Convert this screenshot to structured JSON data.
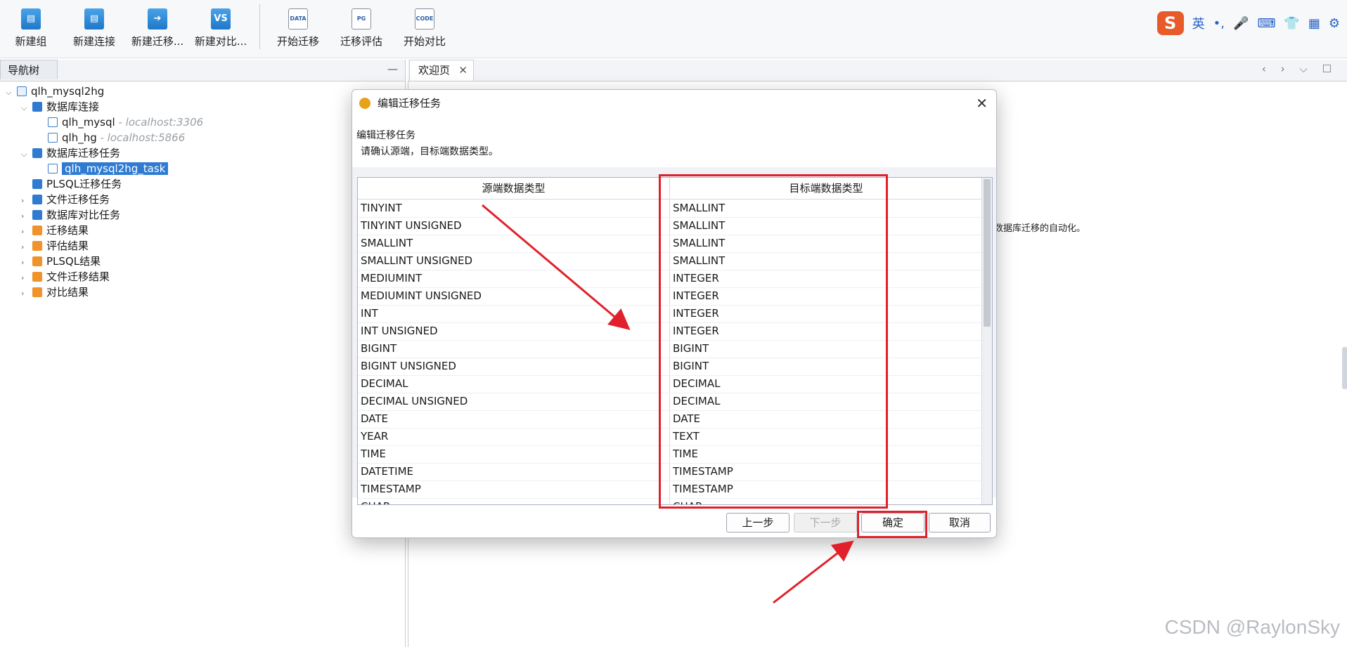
{
  "toolbar": {
    "items": [
      {
        "label": "新建组",
        "icon": "group-icon"
      },
      {
        "label": "新建连接",
        "icon": "connection-icon"
      },
      {
        "label": "新建迁移...",
        "icon": "migration-icon"
      },
      {
        "label": "新建对比...",
        "icon": "compare-icon",
        "glyph": "VS"
      },
      {
        "label": "开始迁移",
        "icon": "data-start-icon",
        "glyph": "DATA"
      },
      {
        "label": "迁移评估",
        "icon": "pg-evaluate-icon",
        "glyph": "PG"
      },
      {
        "label": "开始对比",
        "icon": "code-compare-icon",
        "glyph": "CODE"
      }
    ]
  },
  "ime": {
    "logo": "S",
    "lang": "英",
    "symbols": "•,"
  },
  "nav": {
    "tab": "导航树",
    "minimize": "—",
    "tree": {
      "root": "qlh_mysql2hg",
      "db_conn": "数据库连接",
      "conn1": "qlh_mysql",
      "conn1_host": " - localhost:3306",
      "conn2": "qlh_hg",
      "conn2_host": " - localhost:5866",
      "migration_tasks": "数据库迁移任务",
      "task1": "qlh_mysql2hg_task",
      "plsql": "PLSQL迁移任务",
      "file_mig": "文件迁移任务",
      "db_compare": "数据库对比任务",
      "mig_result": "迁移结果",
      "eval_result": "评估结果",
      "plsql_result": "PLSQL结果",
      "file_result": "文件迁移结果",
      "compare_result": "对比结果"
    }
  },
  "editor": {
    "tab": "欢迎页",
    "tab_close": "✕",
    "controls": "‹ › ⌵ ☐",
    "welcome_fragment": "数据库迁移的自动化。"
  },
  "dialog": {
    "title": "编辑迁移任务",
    "close": "✕",
    "heading": "编辑迁移任务",
    "desc": "请确认源端，目标端数据类型。",
    "col_source": "源端数据类型",
    "col_target": "目标端数据类型",
    "rows": [
      [
        "TINYINT",
        "SMALLINT"
      ],
      [
        "TINYINT UNSIGNED",
        "SMALLINT"
      ],
      [
        "SMALLINT",
        "SMALLINT"
      ],
      [
        "SMALLINT UNSIGNED",
        "SMALLINT"
      ],
      [
        "MEDIUMINT",
        "INTEGER"
      ],
      [
        "MEDIUMINT UNSIGNED",
        "INTEGER"
      ],
      [
        "INT",
        "INTEGER"
      ],
      [
        "INT UNSIGNED",
        "INTEGER"
      ],
      [
        "BIGINT",
        "BIGINT"
      ],
      [
        "BIGINT UNSIGNED",
        "BIGINT"
      ],
      [
        "DECIMAL",
        "DECIMAL"
      ],
      [
        "DECIMAL UNSIGNED",
        "DECIMAL"
      ],
      [
        "DATE",
        "DATE"
      ],
      [
        "YEAR",
        "TEXT"
      ],
      [
        "TIME",
        "TIME"
      ],
      [
        "DATETIME",
        "TIMESTAMP"
      ],
      [
        "TIMESTAMP",
        "TIMESTAMP"
      ],
      [
        "CHAR",
        "CHAR"
      ]
    ],
    "btn_prev": "上一步",
    "btn_next": "下一步",
    "btn_ok": "确定",
    "btn_cancel": "取消"
  },
  "annotation_color": "#e0202a",
  "watermark": "CSDN @RaylonSky"
}
